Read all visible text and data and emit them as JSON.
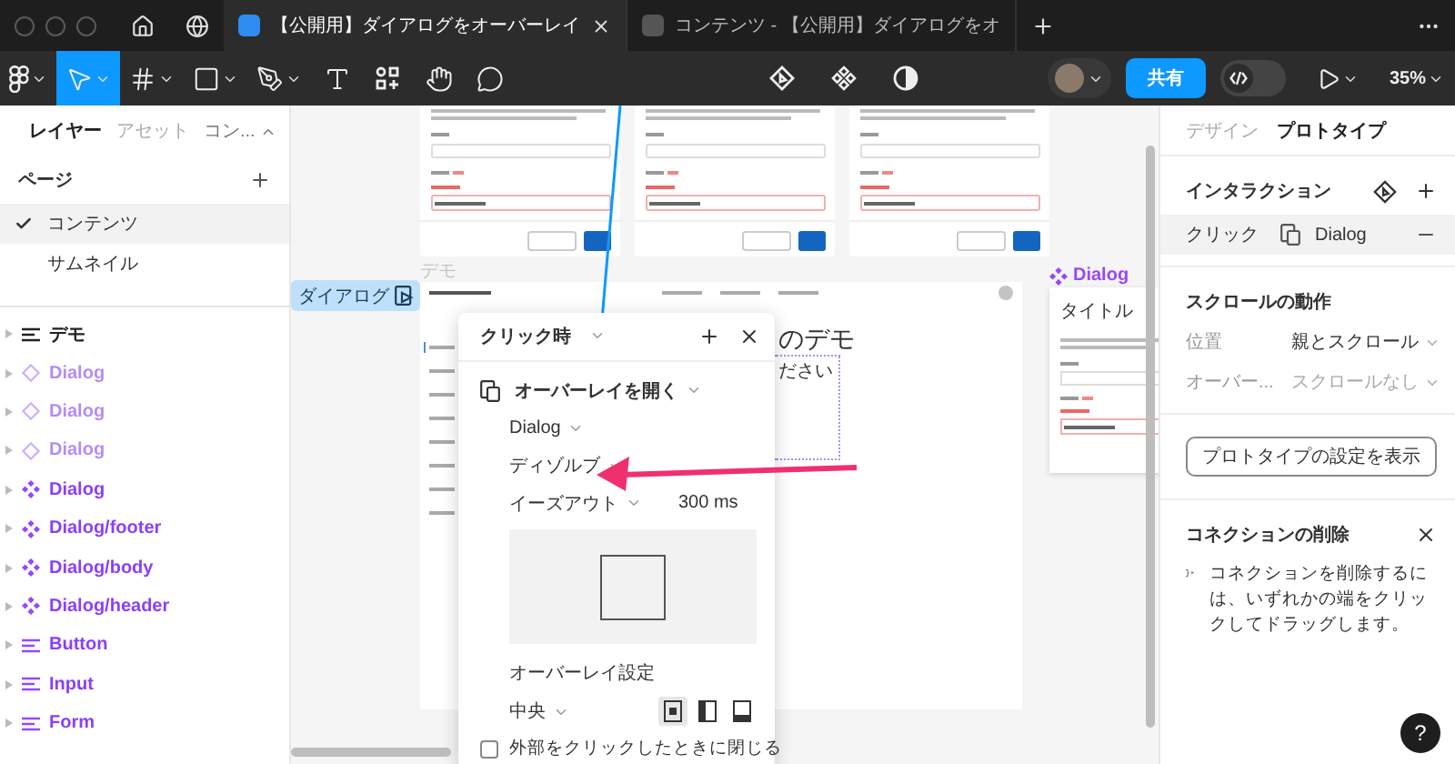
{
  "tab_bar": {
    "tabs": [
      {
        "title": "【公開用】ダイアログをオーバーレイ",
        "selected": true
      },
      {
        "title": "コンテンツ - 【公開用】ダイアログをオ",
        "selected": false
      }
    ]
  },
  "toolbar": {
    "tools": [
      {
        "kind": "move",
        "selected": true
      },
      {
        "kind": "frame",
        "selected": false
      },
      {
        "kind": "shape",
        "selected": false
      },
      {
        "kind": "pen",
        "selected": false
      },
      {
        "kind": "text",
        "selected": false
      },
      {
        "kind": "actions",
        "selected": false
      },
      {
        "kind": "hand",
        "selected": false
      },
      {
        "kind": "comment",
        "selected": false
      }
    ],
    "share": "共有",
    "dev_mode": {
      "on": false
    },
    "zoom": "35%"
  },
  "left_panel": {
    "tabs": [
      {
        "label": "レイヤー",
        "selected": true
      },
      {
        "label": "アセット",
        "selected": false
      }
    ],
    "page_menu": "コン...",
    "pages_title": "ページ",
    "pages": [
      {
        "label": "コンテンツ",
        "selected": true
      },
      {
        "label": "サムネイル",
        "selected": false
      }
    ],
    "layers": [
      {
        "name": "デモ",
        "kind": "frame"
      },
      {
        "name": "Dialog",
        "kind": "variant"
      },
      {
        "name": "Dialog",
        "kind": "variant"
      },
      {
        "name": "Dialog",
        "kind": "variant"
      },
      {
        "name": "Dialog",
        "kind": "component"
      },
      {
        "name": "Dialog/footer",
        "kind": "component"
      },
      {
        "name": "Dialog/body",
        "kind": "component"
      },
      {
        "name": "Dialog/header",
        "kind": "component"
      },
      {
        "name": "Button",
        "kind": "component-frame"
      },
      {
        "name": "Input",
        "kind": "component-frame"
      },
      {
        "name": "Form",
        "kind": "component-frame"
      }
    ]
  },
  "canvas": {
    "section_label": "デモ",
    "prototype_tag": "ダイアログ",
    "demo_frame": {
      "heading": "のデモ",
      "subtext": "ださい"
    },
    "component": {
      "name": "Dialog",
      "title": "タイトル"
    },
    "popup": {
      "trigger": "クリック時",
      "action": "オーバーレイを開く",
      "destination": "Dialog",
      "animation": "ディゾルブ",
      "easing": "イーズアウト",
      "duration": "300 ms",
      "overlay_title": "オーバーレイ設定",
      "position": "中央",
      "position_options": [
        {
          "kind": "center",
          "selected": true
        },
        {
          "kind": "left",
          "selected": false
        },
        {
          "kind": "bottom",
          "selected": false
        }
      ],
      "close_outside": {
        "label": "外部をクリックしたときに閉じる",
        "checked": false
      }
    }
  },
  "right_panel": {
    "tabs": [
      {
        "label": "デザイン",
        "selected": false
      },
      {
        "label": "プロトタイプ",
        "selected": true
      }
    ],
    "interactions_title": "インタラクション",
    "interaction": {
      "trigger": "クリック",
      "target": "Dialog"
    },
    "scroll_title": "スクロールの動作",
    "scroll_rows": [
      {
        "label": "位置",
        "value": "親とスクロール"
      },
      {
        "label": "オーバー...",
        "value": "スクロールなし"
      }
    ],
    "settings_button": "プロトタイプの設定を表示",
    "removal": {
      "title": "コネクションの削除",
      "text": "コネクションを削除するには、いずれかの端をクリックしてドラッグします。"
    }
  },
  "help": "?"
}
